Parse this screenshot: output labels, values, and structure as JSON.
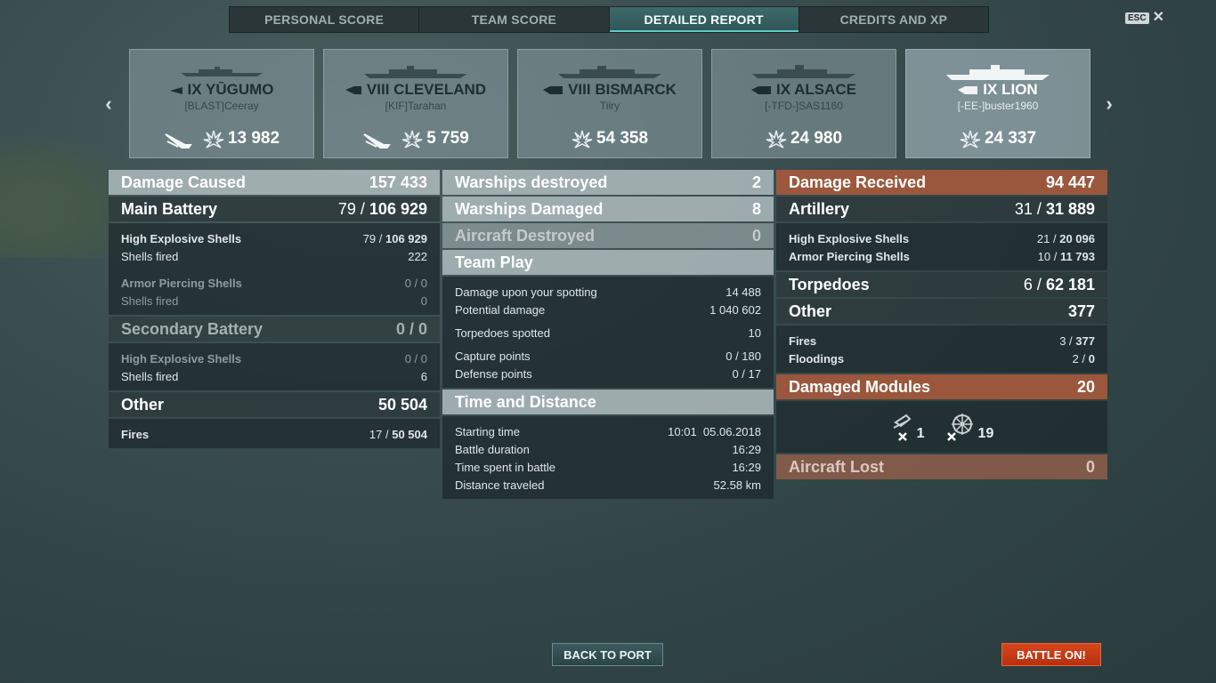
{
  "tabs": [
    {
      "label": "PERSONAL SCORE",
      "active": false
    },
    {
      "label": "TEAM SCORE",
      "active": false
    },
    {
      "label": "DETAILED REPORT",
      "active": true
    },
    {
      "label": "CREDITS AND XP",
      "active": false
    }
  ],
  "esc_label": "ESC",
  "ships": [
    {
      "tier": "IX",
      "name": "YŪGUMO",
      "player": "[BLAST]Ceeray",
      "damage": "13 982",
      "sunk": true
    },
    {
      "tier": "VIII",
      "name": "CLEVELAND",
      "player": "[KIF]Tarahan",
      "damage": "5 759",
      "sunk": true
    },
    {
      "tier": "VIII",
      "name": "BISMARCK",
      "player": "Tiiry",
      "damage": "54 358",
      "sunk": false
    },
    {
      "tier": "IX",
      "name": "ALSACE",
      "player": "[-TFD-]SAS1160",
      "damage": "24 980",
      "sunk": false
    },
    {
      "tier": "IX",
      "name": "LION",
      "player": "[-EE-]buster1960",
      "damage": "24 337",
      "sunk": false
    }
  ],
  "left": {
    "damage_caused": {
      "label": "Damage Caused",
      "value": "157 433"
    },
    "main_battery": {
      "label": "Main Battery",
      "hits": "79 /",
      "value": "106 929"
    },
    "mb_he": {
      "label": "High Explosive Shells",
      "hits": "79 /",
      "value": "106 929"
    },
    "mb_he_fired": {
      "label": "Shells fired",
      "value": "222"
    },
    "mb_ap": {
      "label": "Armor Piercing Shells",
      "value": "0 / 0"
    },
    "mb_ap_fired": {
      "label": "Shells fired",
      "value": "0"
    },
    "secondary": {
      "label": "Secondary Battery",
      "value": "0 / 0"
    },
    "sec_he": {
      "label": "High Explosive Shells",
      "value": "0 / 0"
    },
    "sec_he_fired": {
      "label": "Shells fired",
      "value": "6"
    },
    "other": {
      "label": "Other",
      "value": "50 504"
    },
    "fires": {
      "label": "Fires",
      "hits": "17 /",
      "value": "50 504"
    }
  },
  "middle": {
    "warships_destroyed": {
      "label": "Warships destroyed",
      "value": "2"
    },
    "warships_damaged": {
      "label": "Warships Damaged",
      "value": "8"
    },
    "aircraft_destroyed": {
      "label": "Aircraft Destroyed",
      "value": "0"
    },
    "team_play": {
      "label": "Team Play"
    },
    "spotting": {
      "label": "Damage upon your spotting",
      "value": "14 488"
    },
    "potential": {
      "label": "Potential damage",
      "value": "1 040 602"
    },
    "torps_spotted": {
      "label": "Torpedoes spotted",
      "value": "10"
    },
    "capture": {
      "label": "Capture points",
      "value": "0 / 180"
    },
    "defense": {
      "label": "Defense points",
      "value": "0 / 17"
    },
    "time_distance": {
      "label": "Time and Distance"
    },
    "start_time": {
      "label": "Starting time",
      "value": "10:01  05.06.2018"
    },
    "duration": {
      "label": "Battle duration",
      "value": "16:29"
    },
    "time_spent": {
      "label": "Time spent in battle",
      "value": "16:29"
    },
    "distance": {
      "label": "Distance traveled",
      "value": "52.58 km"
    }
  },
  "right": {
    "damage_received": {
      "label": "Damage Received",
      "value": "94 447"
    },
    "artillery": {
      "label": "Artillery",
      "hits": "31 /",
      "value": "31 889"
    },
    "art_he": {
      "label": "High Explosive Shells",
      "hits": "21 /",
      "value": "20 096"
    },
    "art_ap": {
      "label": "Armor Piercing Shells",
      "hits": "10 /",
      "value": "11 793"
    },
    "torpedoes": {
      "label": "Torpedoes",
      "hits": "6 /",
      "value": "62 181"
    },
    "other": {
      "label": "Other",
      "value": "377"
    },
    "fires": {
      "label": "Fires",
      "hits": "3 /",
      "value": "377"
    },
    "floodings": {
      "label": "Floodings",
      "hits": "2 /",
      "value": "0"
    },
    "modules": {
      "label": "Damaged Modules",
      "value": "20"
    },
    "mod_guns": "1",
    "mod_steering": "19",
    "aircraft_lost": {
      "label": "Aircraft Lost",
      "value": "0"
    }
  },
  "buttons": {
    "back": "BACK TO PORT",
    "battle": "BATTLE ON!"
  }
}
